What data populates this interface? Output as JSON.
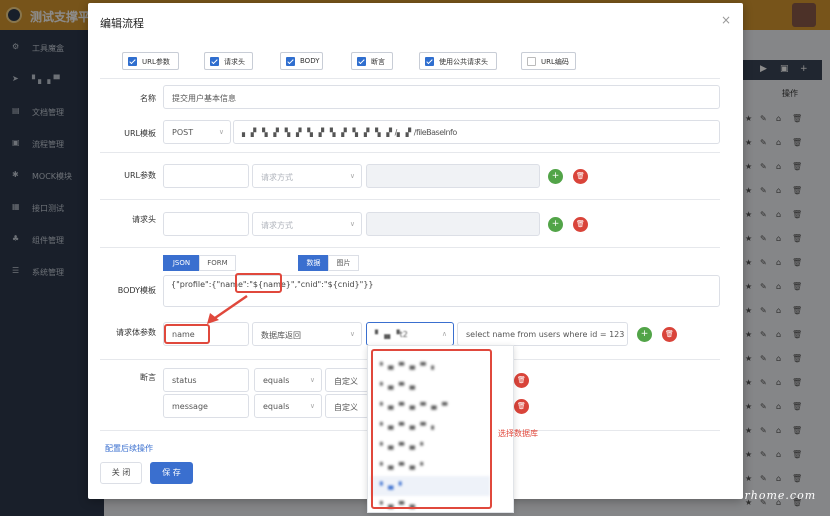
{
  "app": {
    "title": "测试支撑平"
  },
  "sidebar": {
    "items": [
      {
        "icon": "tools-icon",
        "glyph": "⚙",
        "label": "工具魔盒"
      },
      {
        "icon": "send-icon",
        "glyph": "➤",
        "label": "▘▖▗▝▘"
      },
      {
        "icon": "doc-icon",
        "glyph": "▤",
        "label": "文档管理"
      },
      {
        "icon": "flow-icon",
        "glyph": "▣",
        "label": "流程管理"
      },
      {
        "icon": "mock-icon",
        "glyph": "✱",
        "label": "MOCK模块"
      },
      {
        "icon": "grid-icon",
        "glyph": "▦",
        "label": "接口测试"
      },
      {
        "icon": "component-icon",
        "glyph": "♣",
        "label": "组件管理"
      },
      {
        "icon": "list-icon",
        "glyph": "☰",
        "label": "系统管理"
      }
    ]
  },
  "background": {
    "ops_header": "操作"
  },
  "modal": {
    "title": "编辑流程",
    "close": "×",
    "checkboxes": [
      {
        "label": "URL参数",
        "checked": true
      },
      {
        "label": "请求头",
        "checked": true
      },
      {
        "label": "BODY",
        "checked": true
      },
      {
        "label": "断言",
        "checked": true
      },
      {
        "label": "使用公共请求头",
        "checked": true
      },
      {
        "label": "URL编码",
        "checked": false
      }
    ],
    "name": {
      "label": "名称",
      "value": "提交用户基本信息"
    },
    "url": {
      "label": "URL模板",
      "method": "POST",
      "value": "▖▗▘▝▖▗▘▝▖▗▘▝▖▗▘▝▖▗▘▝▖▗▘▝▖▗▘/▖▗▘/fileBaseInfo"
    },
    "url_params": {
      "label": "URL参数",
      "method_placeholder": "请求方式"
    },
    "headers": {
      "label": "请求头",
      "method_placeholder": "请求方式"
    },
    "body": {
      "label": "BODY模板",
      "format_tabs": [
        "JSON",
        "FORM"
      ],
      "type_tabs": [
        "数据",
        "图片"
      ],
      "value": "{\"profile\":{\"name\":\"${name}\",\"cnid\":\"${cnid}\"}}"
    },
    "body_params": {
      "label": "请求体参数",
      "name": "name",
      "source": "数据库返回",
      "database": "▘▗▖▝t2",
      "sql": "select name from users where id = 123"
    },
    "assertions": {
      "label": "断言",
      "rows": [
        {
          "field": "status",
          "op": "equals",
          "type": "自定义"
        },
        {
          "field": "message",
          "op": "equals",
          "type": "自定义"
        }
      ]
    },
    "post_action_link": "配置后续操作",
    "cancel": "关 闭",
    "save": "保 存"
  },
  "dropdown": {
    "items": [
      "▘▗▖▝▘▗▖▝▘▗",
      "▘▗▖▝▘▗▖",
      "▘▗▖▝▘▗▖▝▘▗▖▝▘",
      "▘▗▖▝▘▗▖▝▘▗",
      "▘▗▖▝▘▗▖▝",
      "▘▗▖▝▘▗▖▝",
      "▘▗▖▝",
      "▘▗▖▝▘▗▖"
    ],
    "selected_index": 6,
    "note": "选择数据库"
  },
  "watermark": "testerhome.com"
}
